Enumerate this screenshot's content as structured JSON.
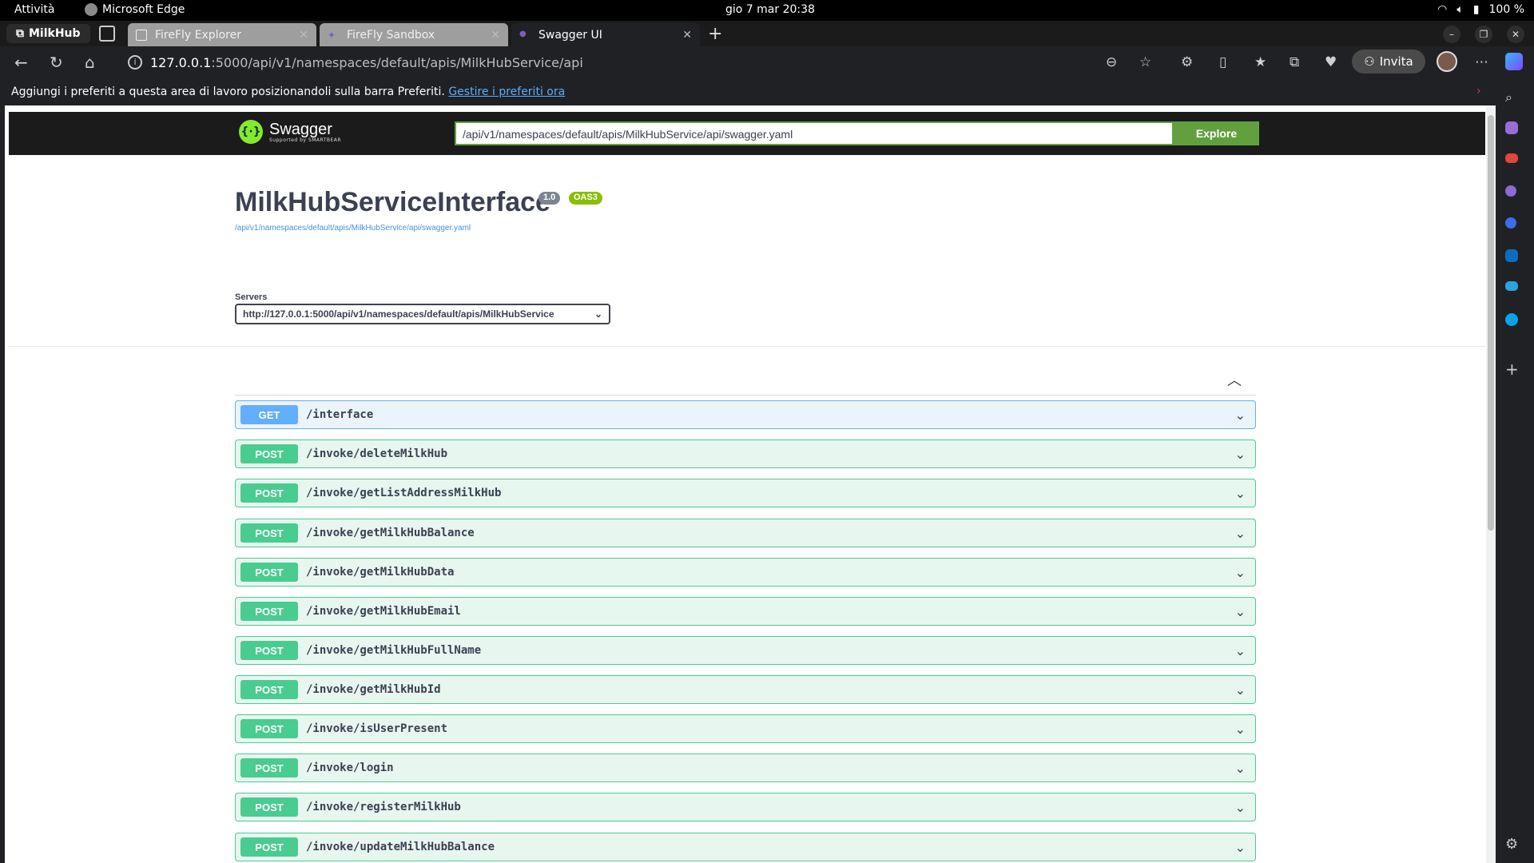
{
  "system": {
    "activities": "Attività",
    "app_name": "Microsoft Edge",
    "clock": "gio 7 mar  20:38",
    "battery": "100 %"
  },
  "browser": {
    "profile": "MilkHub",
    "tabs": [
      {
        "label": "FireFly Explorer"
      },
      {
        "label": "FireFly Sandbox"
      },
      {
        "label": "Swagger UI"
      }
    ],
    "address": {
      "host": "127.0.0.1",
      "path": ":5000/api/v1/namespaces/default/apis/MilkHubService/api"
    },
    "invite_label": "Invita",
    "favbar": {
      "message": "Aggiungi i preferiti a questa area di lavoro posizionandoli sulla barra Preferiti.",
      "link": "Gestire i preferiti ora"
    }
  },
  "swagger": {
    "brand": "Swagger",
    "brand_sub": "Supported by SMARTBEAR",
    "spec_url_value": "/api/v1/namespaces/default/apis/MilkHubService/api/swagger.yaml",
    "explore_label": "Explore",
    "title": "MilkHubServiceInterface",
    "version_badge": "1.0",
    "oas_badge": "OAS3",
    "spec_link": "/api/v1/namespaces/default/apis/MilkHubService/api/swagger.yaml",
    "servers_label": "Servers",
    "server_selected": "http://127.0.0.1:5000/api/v1/namespaces/default/apis/MilkHubService",
    "operations": [
      {
        "method": "GET",
        "path": "/interface"
      },
      {
        "method": "POST",
        "path": "/invoke/deleteMilkHub"
      },
      {
        "method": "POST",
        "path": "/invoke/getListAddressMilkHub"
      },
      {
        "method": "POST",
        "path": "/invoke/getMilkHubBalance"
      },
      {
        "method": "POST",
        "path": "/invoke/getMilkHubData"
      },
      {
        "method": "POST",
        "path": "/invoke/getMilkHubEmail"
      },
      {
        "method": "POST",
        "path": "/invoke/getMilkHubFullName"
      },
      {
        "method": "POST",
        "path": "/invoke/getMilkHubId"
      },
      {
        "method": "POST",
        "path": "/invoke/isUserPresent"
      },
      {
        "method": "POST",
        "path": "/invoke/login"
      },
      {
        "method": "POST",
        "path": "/invoke/registerMilkHub"
      },
      {
        "method": "POST",
        "path": "/invoke/updateMilkHubBalance"
      }
    ]
  },
  "colors": {
    "get": "#61affe",
    "post": "#49cc90",
    "swagger_green": "#62a03f",
    "title": "#3b4151"
  },
  "icons": [
    "wifi-icon",
    "volume-icon",
    "battery-icon",
    "back-icon",
    "reload-icon",
    "home-icon",
    "info-icon",
    "zoom-icon",
    "star-icon",
    "extensions-icon",
    "split-icon",
    "favorites-icon",
    "collections-icon",
    "performance-icon",
    "more-icon",
    "chevron-down-icon",
    "chevron-up-icon"
  ]
}
